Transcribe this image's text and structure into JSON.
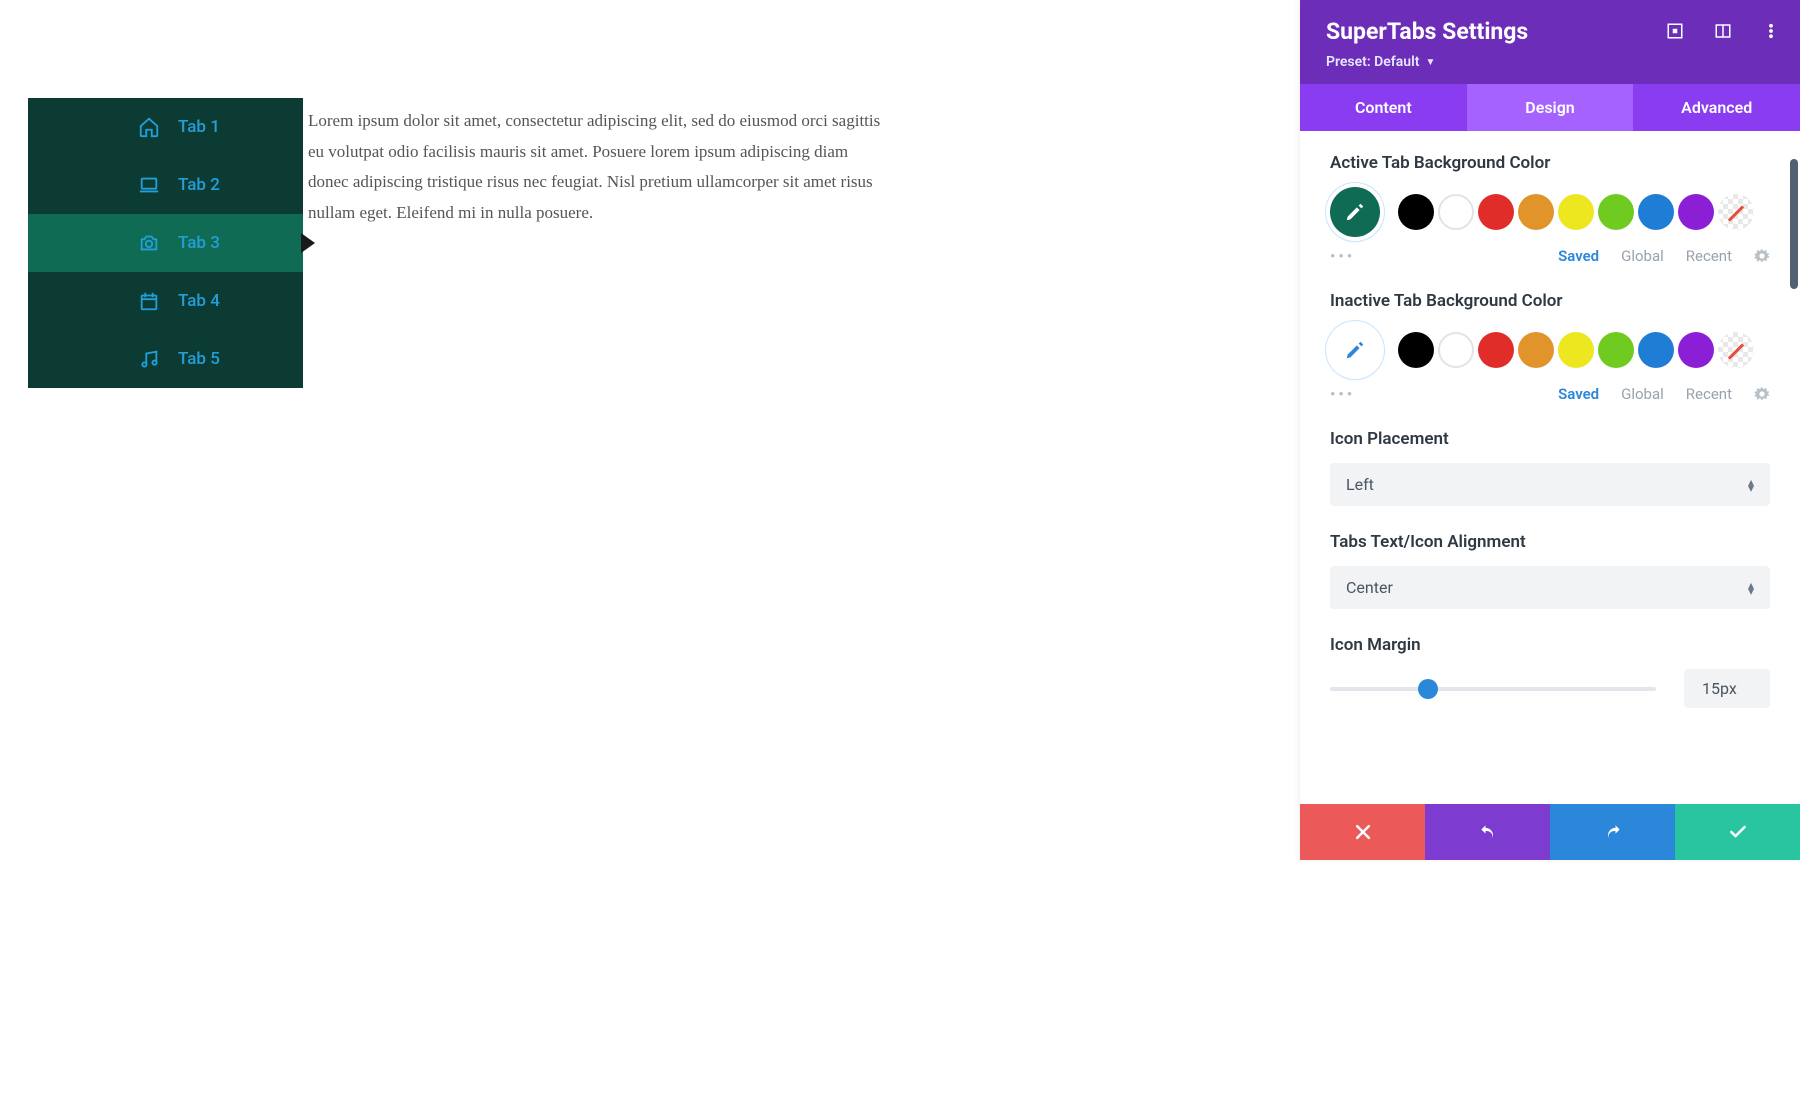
{
  "preview": {
    "tabs": [
      {
        "label": "Tab 1"
      },
      {
        "label": "Tab 2"
      },
      {
        "label": "Tab 3"
      },
      {
        "label": "Tab 4"
      },
      {
        "label": "Tab 5"
      }
    ],
    "active_index": 2,
    "body_text": "Lorem ipsum dolor sit amet, consectetur adipiscing elit, sed do eiusmod orci sagittis eu volutpat odio facilisis mauris sit amet. Posuere lorem ipsum adipiscing diam donec adipiscing tristique risus nec feugiat. Nisl pretium ullamcorper sit amet risus nullam eget. Eleifend mi in nulla posuere."
  },
  "panel": {
    "title": "SuperTabs Settings",
    "preset_label": "Preset: Default",
    "tabs": {
      "content": "Content",
      "design": "Design",
      "advanced": "Advanced",
      "active": "design"
    },
    "fields": {
      "active_bg": {
        "label": "Active Tab Background Color",
        "current": "#0f6b53"
      },
      "inactive_bg": {
        "label": "Inactive Tab Background Color",
        "current": "#ffffff"
      },
      "icon_placement": {
        "label": "Icon Placement",
        "value": "Left"
      },
      "alignment": {
        "label": "Tabs Text/Icon Alignment",
        "value": "Center"
      },
      "icon_margin": {
        "label": "Icon Margin",
        "value": "15px",
        "percent": 30
      }
    },
    "palette": [
      "#000000",
      "outline",
      "#e12d2a",
      "#e0942a",
      "#ece71f",
      "#6fcb1f",
      "#1f7dd6",
      "#8a1fd6",
      "none"
    ],
    "palette_footer": {
      "saved": "Saved",
      "global": "Global",
      "recent": "Recent"
    }
  }
}
